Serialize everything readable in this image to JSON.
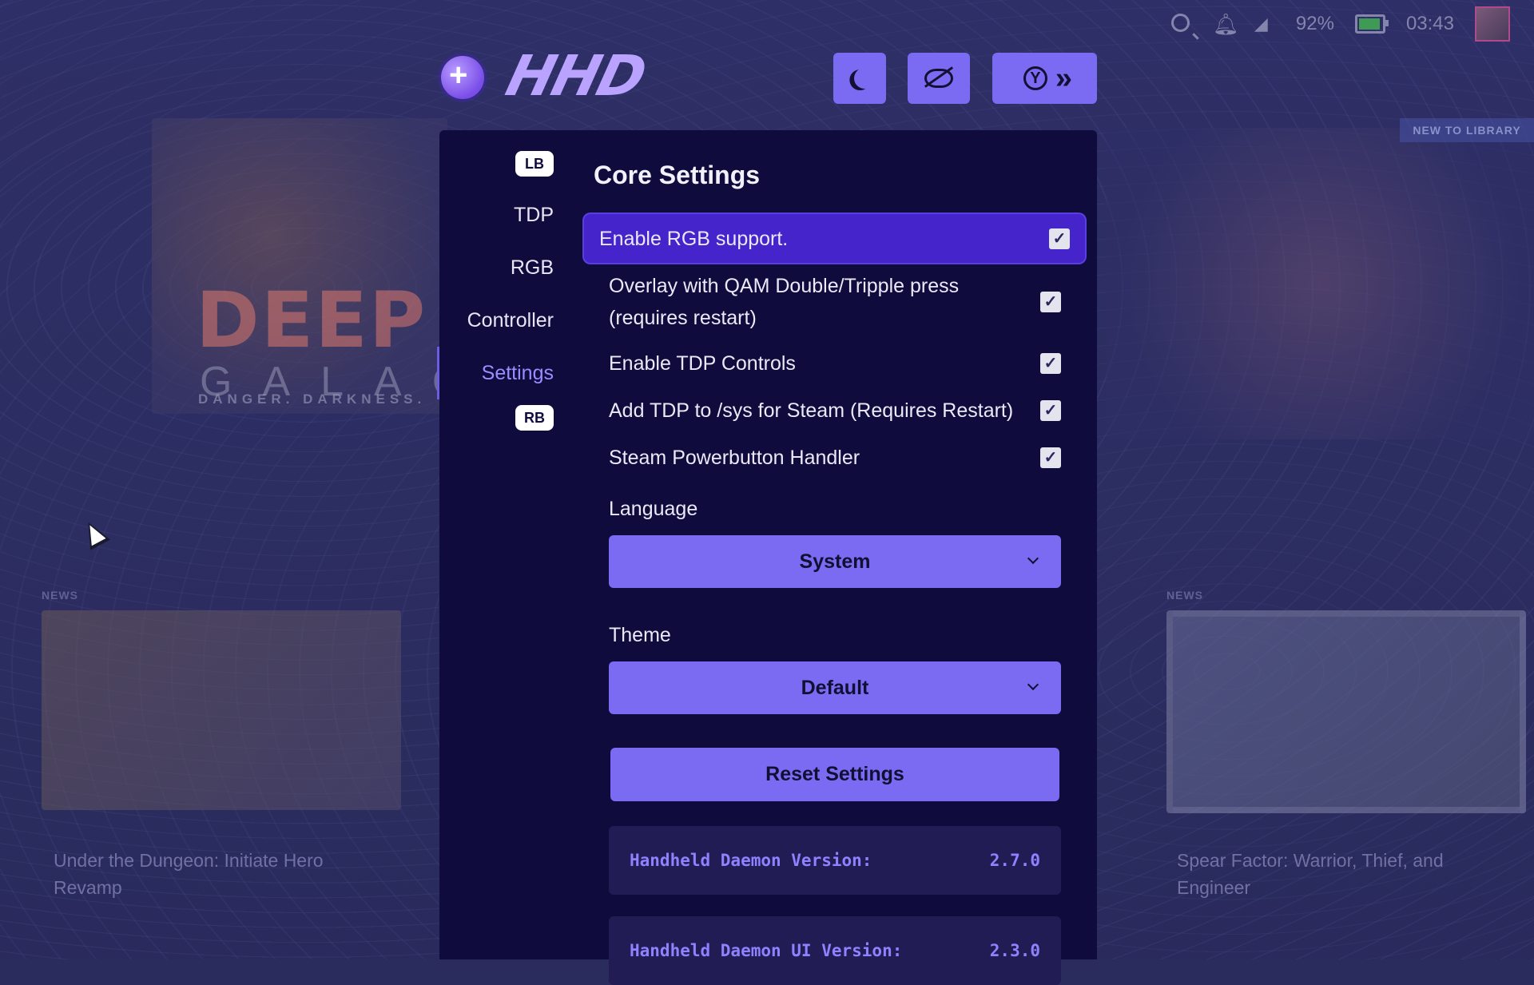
{
  "status_bar": {
    "battery": "92%",
    "battery_level": 0.92,
    "time": "03:43"
  },
  "background": {
    "hero_title": "DEEP RO",
    "hero_subtitle": "GALACT",
    "hero_tagline": "DANGER. DARKNESS.",
    "new_to_library": "NEW TO LIBRARY",
    "news_label": "NEWS",
    "left_news_caption": "Under the Dungeon: Initiate Hero Revamp",
    "right_news_caption": "Spear Factor: Warrior, Thief, and Engineer"
  },
  "logo": {
    "text": "HHD"
  },
  "sidebar": {
    "lb": "LB",
    "rb": "RB",
    "items": [
      {
        "label": "TDP"
      },
      {
        "label": "RGB"
      },
      {
        "label": "Controller"
      },
      {
        "label": "Settings"
      }
    ]
  },
  "content": {
    "title": "Core Settings",
    "options": [
      {
        "label": "Enable RGB support.",
        "checked": true
      },
      {
        "label": "Overlay with QAM Double/Tripple press (requires restart)",
        "checked": true
      },
      {
        "label": "Enable TDP Controls",
        "checked": true
      },
      {
        "label": "Add TDP to /sys for Steam (Requires Restart)",
        "checked": true
      },
      {
        "label": "Steam Powerbutton Handler",
        "checked": true
      }
    ],
    "language": {
      "label": "Language",
      "value": "System"
    },
    "theme": {
      "label": "Theme",
      "value": "Default"
    },
    "reset_label": "Reset Settings",
    "versions": [
      {
        "label": "Handheld Daemon Version:",
        "value": "2.7.0"
      },
      {
        "label": "Handheld Daemon UI Version:",
        "value": "2.3.0"
      }
    ]
  },
  "colors": {
    "panel_bg": "#0f0b3c",
    "accent": "#7a6bf2",
    "highlight": "#4524cc",
    "active_nav": "#9b8cff"
  }
}
